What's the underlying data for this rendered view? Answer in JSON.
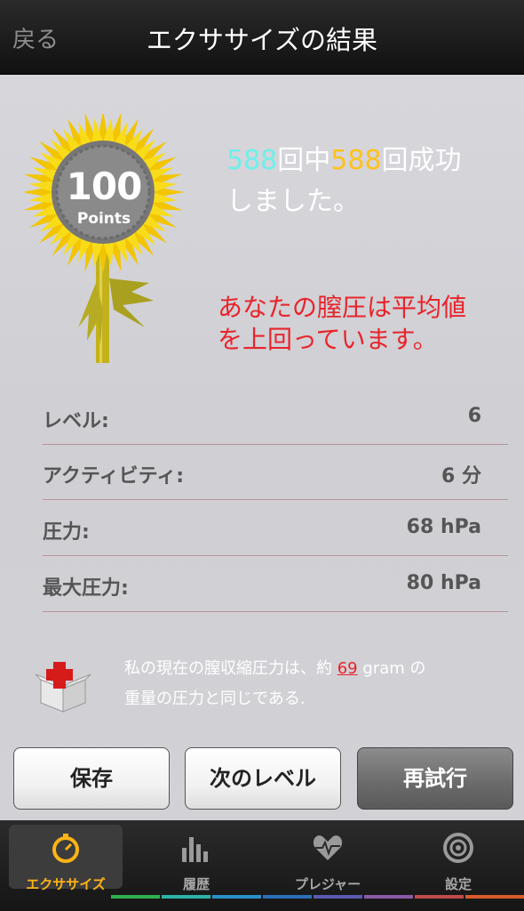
{
  "nav": {
    "back_label": "戻る",
    "title": "エクササイズの結果"
  },
  "badge": {
    "number": "100",
    "unit": "Points"
  },
  "result": {
    "count_done": "588",
    "text_middle": "回中",
    "count_success": "588",
    "text_end": "回成功",
    "line2": "しました。"
  },
  "message": {
    "line1": "あなたの膣圧は平均値",
    "line2": "を上回っています。"
  },
  "stats": [
    {
      "label": "レベル:",
      "value": "6"
    },
    {
      "label": "アクティビティ:",
      "value": "6 分"
    },
    {
      "label": "圧力:",
      "value": "68 hPa"
    },
    {
      "label": "最大圧力:",
      "value": "80 hPa"
    }
  ],
  "info": {
    "prefix": "私の現在の膣収縮圧力は、約 ",
    "amount": "69",
    "suffix": " gram の",
    "line2": "重量の圧力と同じである."
  },
  "buttons": {
    "save": "保存",
    "next_level": "次のレベル",
    "retry": "再試行"
  },
  "tabs": [
    {
      "label": "エクササイズ",
      "icon": "stopwatch-icon",
      "active": true
    },
    {
      "label": "履歴",
      "icon": "bar-chart-icon",
      "active": false
    },
    {
      "label": "プレジャー",
      "icon": "heart-pulse-icon",
      "active": false
    },
    {
      "label": "設定",
      "icon": "target-icon",
      "active": false
    }
  ],
  "colors": {
    "highlight_cyan": "#6ff0ea",
    "highlight_yellow": "#ffc21a",
    "alert_red": "#e8242a",
    "active_tab": "#ffb416"
  }
}
